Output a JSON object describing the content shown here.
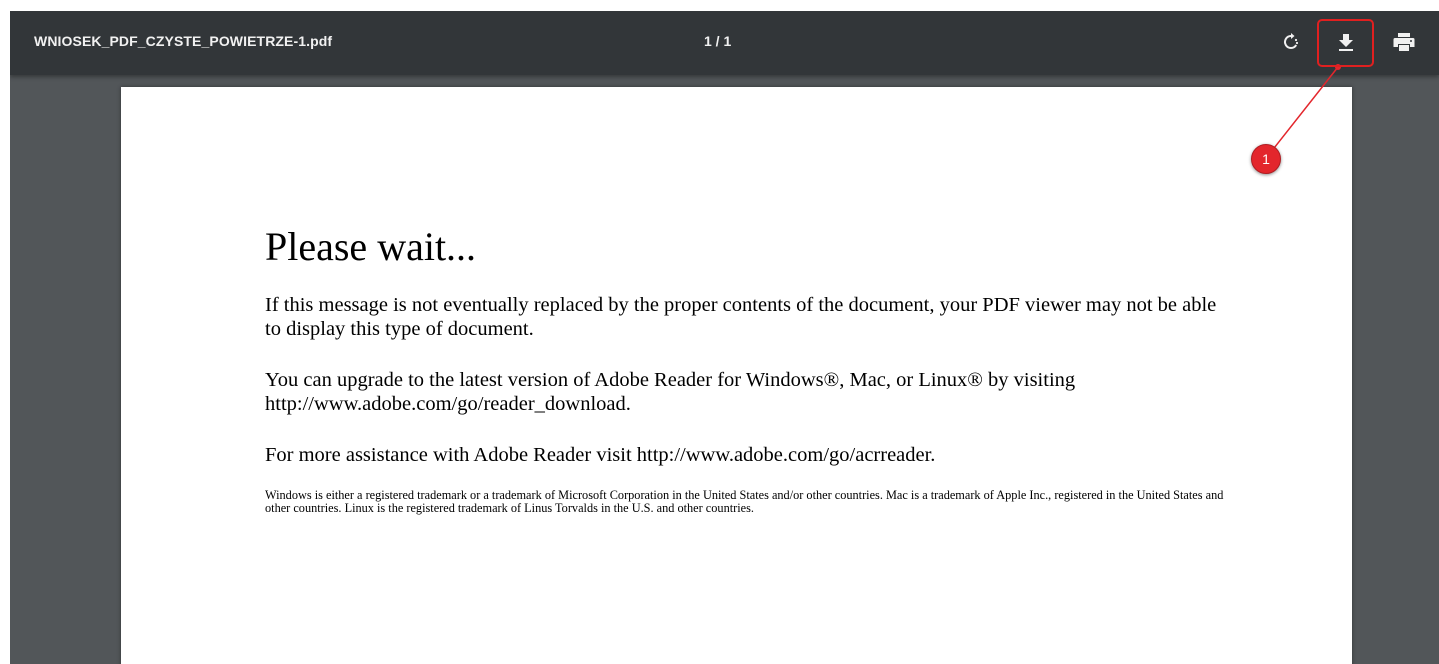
{
  "viewer": {
    "file_name": "WNIOSEK_PDF_CZYSTE_POWIETRZE-1.pdf",
    "page_indicator": "1 / 1",
    "buttons": {
      "rotate_icon": "rotate-icon",
      "download_icon": "download-icon",
      "print_icon": "print-icon"
    }
  },
  "document": {
    "heading": "Please wait...",
    "paragraph_1": "If this message is not eventually replaced by the proper contents of the document, your PDF viewer may not be able to display this type of document.",
    "paragraph_2": "You can upgrade to the latest version of Adobe Reader for Windows®, Mac, or Linux® by visiting  http://www.adobe.com/go/reader_download.",
    "paragraph_3": "For more assistance with Adobe Reader visit  http://www.adobe.com/go/acrreader.",
    "fineprint": "Windows is either a registered trademark or a trademark of Microsoft Corporation in the United States and/or other countries. Mac is a trademark of Apple Inc., registered in the United States and other countries. Linux is the registered trademark of Linus Torvalds in the U.S. and other countries."
  },
  "annotation": {
    "badge_number": "1",
    "color": "#e3262c"
  },
  "colors": {
    "toolbar_bg": "#323639",
    "viewer_bg": "#525659",
    "page_bg": "#ffffff"
  }
}
